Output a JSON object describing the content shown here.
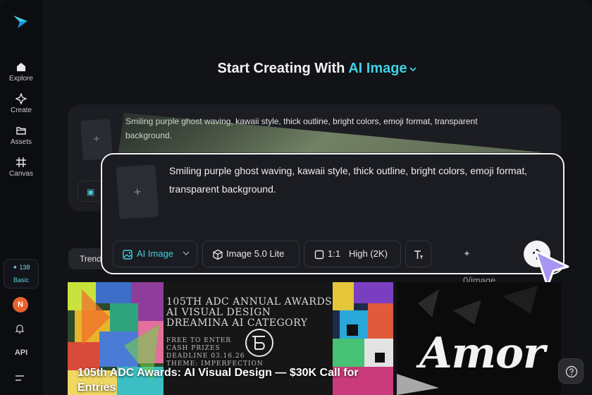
{
  "sidebar": {
    "items": [
      {
        "label": "Explore",
        "icon": "home-icon"
      },
      {
        "label": "Create",
        "icon": "sparkle-icon"
      },
      {
        "label": "Assets",
        "icon": "folder-icon"
      },
      {
        "label": "Canvas",
        "icon": "canvas-icon"
      }
    ],
    "credits_value": "✦ 138",
    "plan": "Basic",
    "avatar_initial": "N",
    "api_label": "API"
  },
  "header": {
    "prefix": "Start Creating With ",
    "accent": "AI Image"
  },
  "prompt": {
    "text": "Smiling purple ghost waving, kawaii style, thick outline, bright colors, emoji format, transparent background.",
    "thumb_plus": "+"
  },
  "toolbar": {
    "type_label": "AI Image",
    "model_label": "Image 5.0 Lite",
    "ratio_label": "1:1",
    "quality_label": "High (2K)",
    "cost_label": "✦ 0/image"
  },
  "tabs": {
    "trending_label": "Trend"
  },
  "banners": {
    "left": {
      "line1": "105TH ADC ANNUAL AWARDS",
      "line2": "AI VISUAL DESIGN",
      "line3": "DREAMINA AI CATEGORY",
      "small1": "FREE TO ENTER",
      "small2": "CASH PRIZES",
      "small3": "DEADLINE 03.16.26",
      "small4": "THEME: IMPERFECTION",
      "caption": "105th ADC Awards: AI Visual Design — $30K Call for Entries"
    },
    "right": {
      "title": "Amor"
    }
  },
  "colors": {
    "accent": "#3fd0e6",
    "background": "#121317",
    "card": "#1b1c21"
  }
}
